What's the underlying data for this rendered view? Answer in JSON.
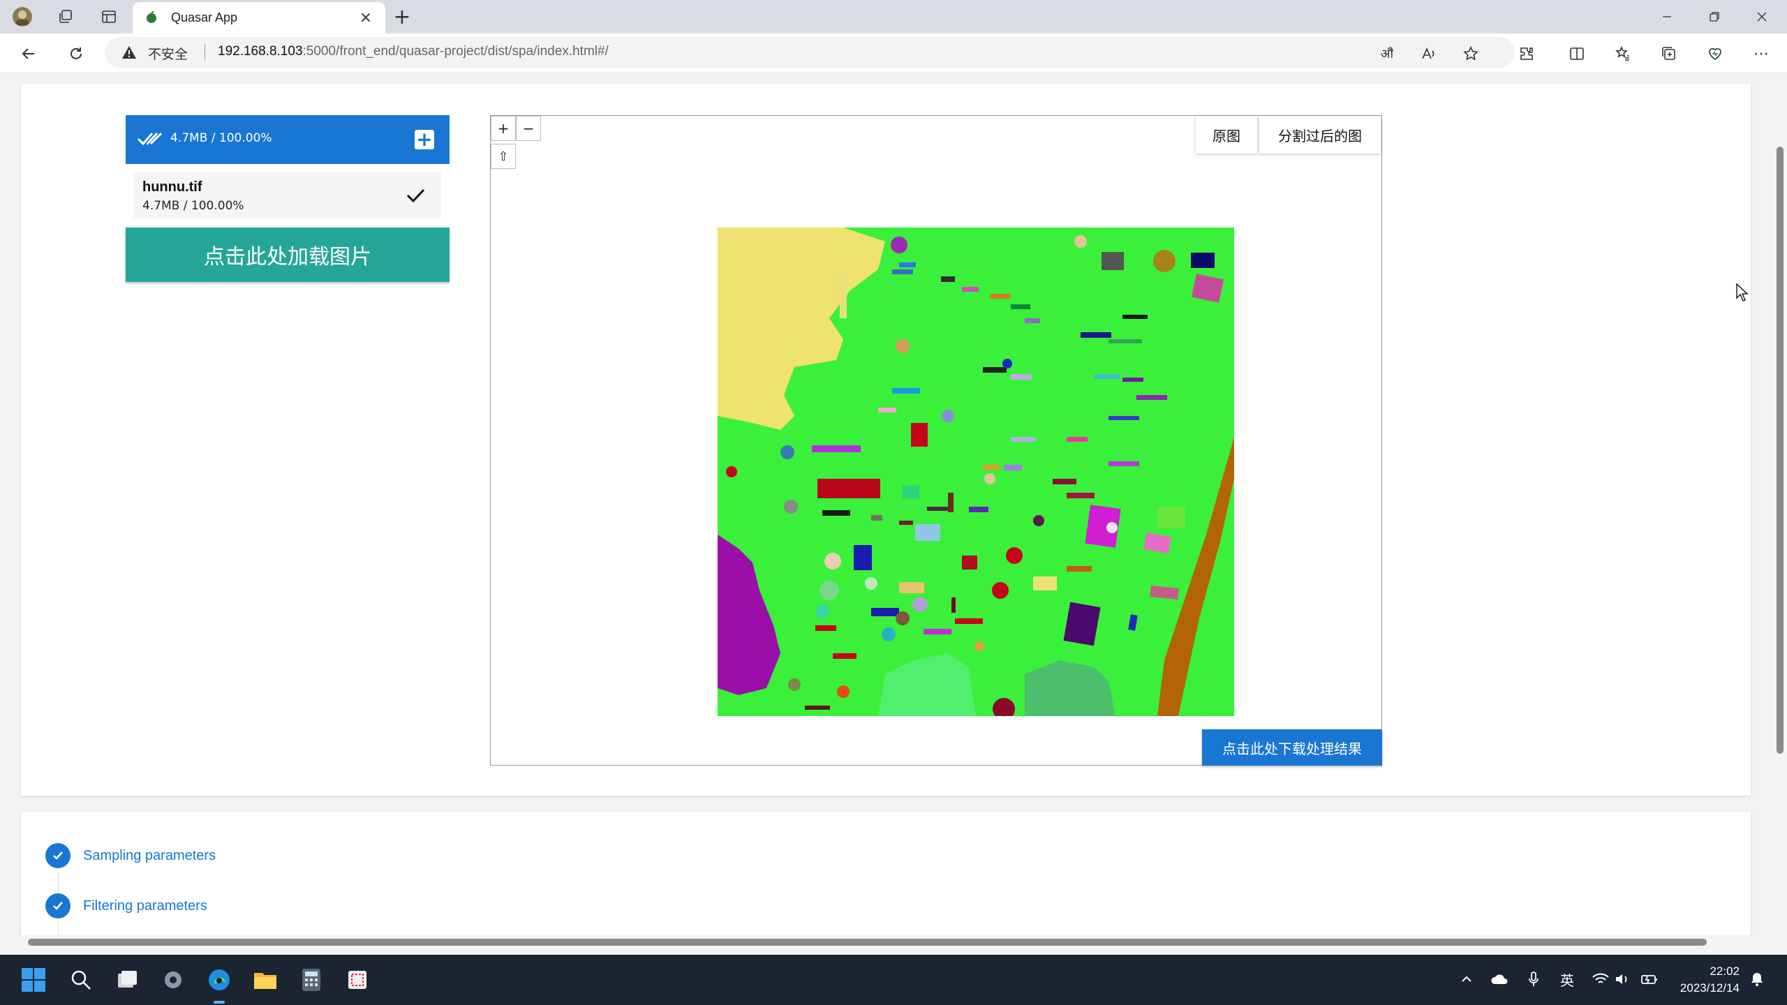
{
  "browser": {
    "tab_title": "Quasar App",
    "security_label": "不安全",
    "url_host": "192.168.8.103",
    "url_rest": ":5000/front_end/quasar-project/dist/spa/index.html#/"
  },
  "uploader": {
    "summary": "4.7MB / 100.00%",
    "file_name": "hunnu.tif",
    "file_size": "4.7MB / 100.00%",
    "load_button": "点击此处加载图片"
  },
  "map": {
    "zoom_in": "+",
    "zoom_out": "−",
    "home": "⇧",
    "original_btn": "原图",
    "segmented_btn": "分割过后的图",
    "download_btn": "点击此处下载处理结果"
  },
  "steps": [
    {
      "label": "Sampling parameters"
    },
    {
      "label": "Filtering parameters"
    }
  ],
  "taskbar": {
    "ime": "英",
    "time": "22:02",
    "date": "2023/12/14"
  },
  "colors": {
    "primary": "#1976d2",
    "teal": "#26a69a",
    "segment_background": "#3af03a"
  }
}
